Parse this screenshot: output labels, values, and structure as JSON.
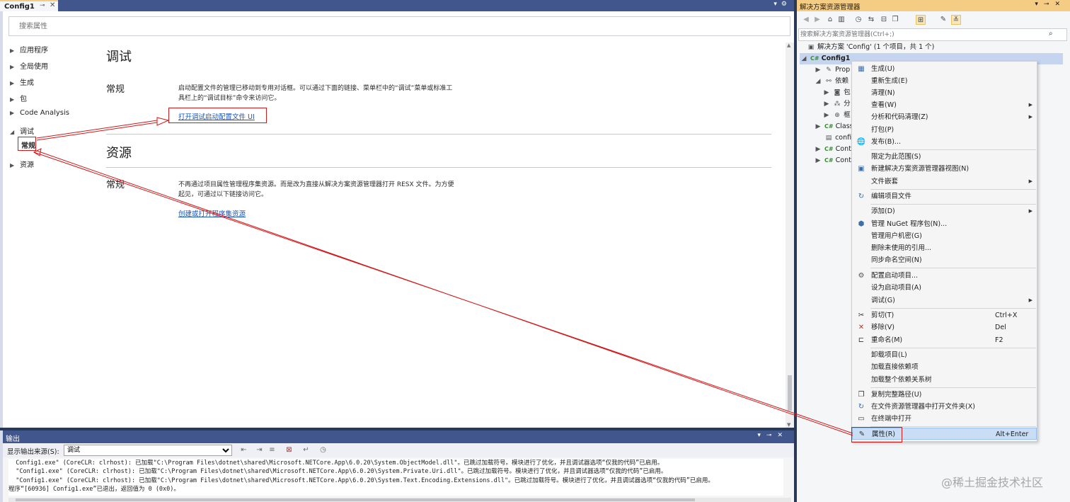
{
  "doc": {
    "tab_title": "Config1",
    "search_placeholder": "搜索属性",
    "tree": [
      {
        "label": "应用程序"
      },
      {
        "label": "全局使用"
      },
      {
        "label": "生成"
      },
      {
        "label": "包"
      },
      {
        "label": "Code Analysis"
      },
      {
        "label": "调试"
      },
      {
        "label": "资源"
      }
    ],
    "tree_child": "常规",
    "debug": {
      "title": "调试",
      "general": "常规",
      "desc": "启动配置文件的管理已移动到专用对话框。可以通过下面的链接、菜单栏中的“调试”菜单或标准工具栏上的“调试目标”命令来访问它。",
      "link": "打开调试启动配置文件 UI"
    },
    "resources": {
      "title": "资源",
      "general": "常规",
      "desc": "不再通过项目属性管理程序集资源。而是改为直接从解决方案资源管理器打开 RESX 文件。为方便起见，可通过以下链接访问它。",
      "link": "创建或打开程序集资源"
    }
  },
  "output": {
    "title": "输出",
    "source_label": "显示输出来源(S):",
    "source_value": "调试",
    "lines": [
      "  Config1.exe\" (CoreCLR: clrhost): 已加载\"C:\\Program Files\\dotnet\\shared\\Microsoft.NETCore.App\\6.0.20\\System.ObjectModel.dll\"。已跳过加载符号。模块进行了优化，并且调试器选项“仅我的代码”已启用。",
      "  \"Config1.exe\" (CoreCLR: clrhost): 已加载\"C:\\Program Files\\dotnet\\shared\\Microsoft.NETCore.App\\6.0.20\\System.Private.Uri.dll\"。已跳过加载符号。模块进行了优化，并且调试器选项“仅我的代码”已启用。",
      "  \"Config1.exe\" (CoreCLR: clrhost): 已加载\"C:\\Program Files\\dotnet\\shared\\Microsoft.NETCore.App\\6.0.20\\System.Text.Encoding.Extensions.dll\"。已跳过加载符号。模块进行了优化，并且调试器选项“仅我的代码”已启用。",
      "程序“[60936] Config1.exe”已退出，返回值为 0 (0x0)。"
    ]
  },
  "solution": {
    "title": "解决方案资源管理器",
    "search_placeholder": "搜索解决方案资源管理器(Ctrl+;)",
    "rows": [
      {
        "label": "解决方案 'Config' (1 个项目，共 1 个)"
      },
      {
        "label": "Config1"
      },
      {
        "label": "Prop"
      },
      {
        "label": "依赖"
      },
      {
        "label": "包"
      },
      {
        "label": "分"
      },
      {
        "label": "框"
      },
      {
        "label": "Class"
      },
      {
        "label": "confi"
      },
      {
        "label": "Cont"
      },
      {
        "label": "Cont"
      }
    ]
  },
  "menu": {
    "items": [
      {
        "label": "生成(U)",
        "icon": "build-icon"
      },
      {
        "label": "重新生成(E)"
      },
      {
        "label": "清理(N)"
      },
      {
        "label": "查看(W)",
        "submenu": true
      },
      {
        "label": "分析和代码清理(Z)",
        "submenu": true
      },
      {
        "label": "打包(P)"
      },
      {
        "label": "发布(B)...",
        "icon": "globe-icon"
      },
      {
        "label": "限定为此范围(S)"
      },
      {
        "label": "新建解决方案资源管理器视图(N)",
        "icon": "new-view-icon"
      },
      {
        "label": "文件嵌套",
        "submenu": true
      },
      {
        "label": "编辑项目文件",
        "icon": "refresh-icon"
      },
      {
        "label": "添加(D)",
        "submenu": true
      },
      {
        "label": "管理 NuGet 程序包(N)...",
        "icon": "nuget-icon"
      },
      {
        "label": "管理用户机密(G)"
      },
      {
        "label": "删除未使用的引用..."
      },
      {
        "label": "同步命名空间(N)"
      },
      {
        "label": "配置启动项目...",
        "icon": "gear-icon"
      },
      {
        "label": "设为启动项目(A)"
      },
      {
        "label": "调试(G)",
        "submenu": true
      },
      {
        "label": "剪切(T)",
        "shortcut": "Ctrl+X",
        "icon": "scissors-icon"
      },
      {
        "label": "移除(V)",
        "shortcut": "Del",
        "icon": "remove-icon"
      },
      {
        "label": "重命名(M)",
        "shortcut": "F2",
        "icon": "rename-icon"
      },
      {
        "label": "卸载项目(L)"
      },
      {
        "label": "加载直接依赖项"
      },
      {
        "label": "加载整个依赖关系树"
      },
      {
        "label": "复制完整路径(U)",
        "icon": "copy-icon"
      },
      {
        "label": "在文件资源管理器中打开文件夹(X)",
        "icon": "refresh-icon"
      },
      {
        "label": "在终端中打开",
        "icon": "terminal-icon"
      },
      {
        "label": "属性(R)",
        "shortcut": "Alt+Enter",
        "icon": "wrench-icon",
        "highlighted": true
      }
    ]
  },
  "watermark": "@稀土掘金技术社区",
  "colors": {
    "title_bar": "#40568d",
    "active_tab_accent": "#f5cc84",
    "annotation_red": "#d11a1a",
    "link_blue": "#1a55b8",
    "menu_highlight": "#c9def5"
  }
}
